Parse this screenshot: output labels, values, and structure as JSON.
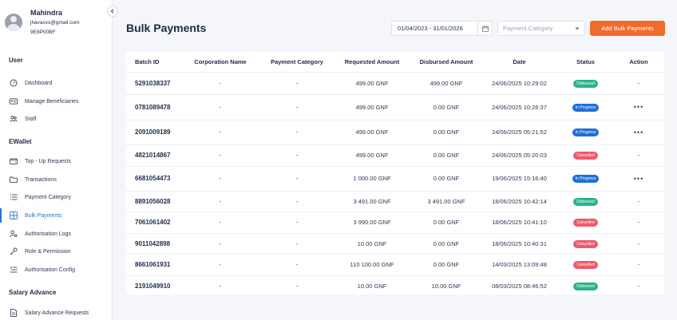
{
  "profile": {
    "name": "Mahindra",
    "email": "jhavasvx@gmail.com",
    "id": "9E8P00BF"
  },
  "sidebar": {
    "sections": [
      {
        "title": "User",
        "items": [
          {
            "label": "Dashboard",
            "icon": "dashboard-icon"
          },
          {
            "label": "Manage Beneficiaries",
            "icon": "id-card-icon"
          },
          {
            "label": "Staff",
            "icon": "people-icon"
          }
        ]
      },
      {
        "title": "EWallet",
        "items": [
          {
            "label": "Top - Up Requests",
            "icon": "wallet-icon"
          },
          {
            "label": "Transactions",
            "icon": "folder-icon"
          },
          {
            "label": "Payment Category",
            "icon": "list-icon"
          },
          {
            "label": "Bulk Payments",
            "icon": "grid-icon",
            "active": true
          },
          {
            "label": "Authorisation Logs",
            "icon": "user-key-icon"
          },
          {
            "label": "Role & Permission",
            "icon": "key-icon"
          },
          {
            "label": "Authorisation Config",
            "icon": "config-list-icon"
          }
        ]
      },
      {
        "title": "Salary Advance",
        "items": [
          {
            "label": "Salary Advance Requests",
            "icon": "document-icon"
          }
        ]
      }
    ]
  },
  "header": {
    "title": "Bulk Payments",
    "date_range": "01/04/2023 - 31/01/2026",
    "category_placeholder": "Payment Category",
    "add_button": "Add Bulk Payments"
  },
  "table": {
    "columns": [
      "Batch ID",
      "Corporation Name",
      "Payment Category",
      "Requested Amount",
      "Disbursed Amount",
      "Date",
      "Status",
      "Action"
    ],
    "rows": [
      {
        "batch": "5291038337",
        "corp": "-",
        "category": "-",
        "requested": "499.00 GNF",
        "disbursed": "499.00 GNF",
        "date": "24/06/2025 10:29:02",
        "status": "Disbursed",
        "action": "-"
      },
      {
        "batch": "0781089478",
        "corp": "-",
        "category": "-",
        "requested": "499.00 GNF",
        "disbursed": "0.00 GNF",
        "date": "24/06/2025 10:26:37",
        "status": "In Progress",
        "action": "•••"
      },
      {
        "batch": "2091009189",
        "corp": "-",
        "category": "-",
        "requested": "499.00 GNF",
        "disbursed": "0.00 GNF",
        "date": "24/06/2025 05:21:52",
        "status": "In Progress",
        "action": "•••"
      },
      {
        "batch": "4821014867",
        "corp": "-",
        "category": "-",
        "requested": "499.00 GNF",
        "disbursed": "0.00 GNF",
        "date": "24/06/2025 05:20:03",
        "status": "Cancelled",
        "action": "-"
      },
      {
        "batch": "6681054473",
        "corp": "-",
        "category": "-",
        "requested": "1 000.00 GNF",
        "disbursed": "0.00 GNF",
        "date": "19/06/2025 15:16:40",
        "status": "In Progress",
        "action": "•••"
      },
      {
        "batch": "8891056028",
        "corp": "-",
        "category": "-",
        "requested": "3 491.00 GNF",
        "disbursed": "3 491.00 GNF",
        "date": "18/06/2025 10:42:14",
        "status": "Disbursed",
        "action": "-"
      },
      {
        "batch": "7061061402",
        "corp": "-",
        "category": "-",
        "requested": "3 990.00 GNF",
        "disbursed": "0.00 GNF",
        "date": "18/06/2025 10:41:10",
        "status": "Cancelled",
        "action": "-"
      },
      {
        "batch": "9011042898",
        "corp": "-",
        "category": "-",
        "requested": "10.00 GNF",
        "disbursed": "0.00 GNF",
        "date": "18/06/2025 10:40:31",
        "status": "Cancelled",
        "action": "-"
      },
      {
        "batch": "8661061931",
        "corp": "-",
        "category": "-",
        "requested": "110 100.00 GNF",
        "disbursed": "0.00 GNF",
        "date": "14/03/2025 13:09:48",
        "status": "Cancelled",
        "action": "-"
      },
      {
        "batch": "2191049910",
        "corp": "-",
        "category": "-",
        "requested": "10.00 GNF",
        "disbursed": "10.00 GNF",
        "date": "08/03/2025 08:46:52",
        "status": "Disbursed",
        "action": "-"
      }
    ]
  },
  "status_colors": {
    "Disbursed": "#2bb38a",
    "In Progress": "#1f6fd8",
    "Cancelled": "#ee5a6b"
  },
  "accent_color": "#ef6c2c"
}
